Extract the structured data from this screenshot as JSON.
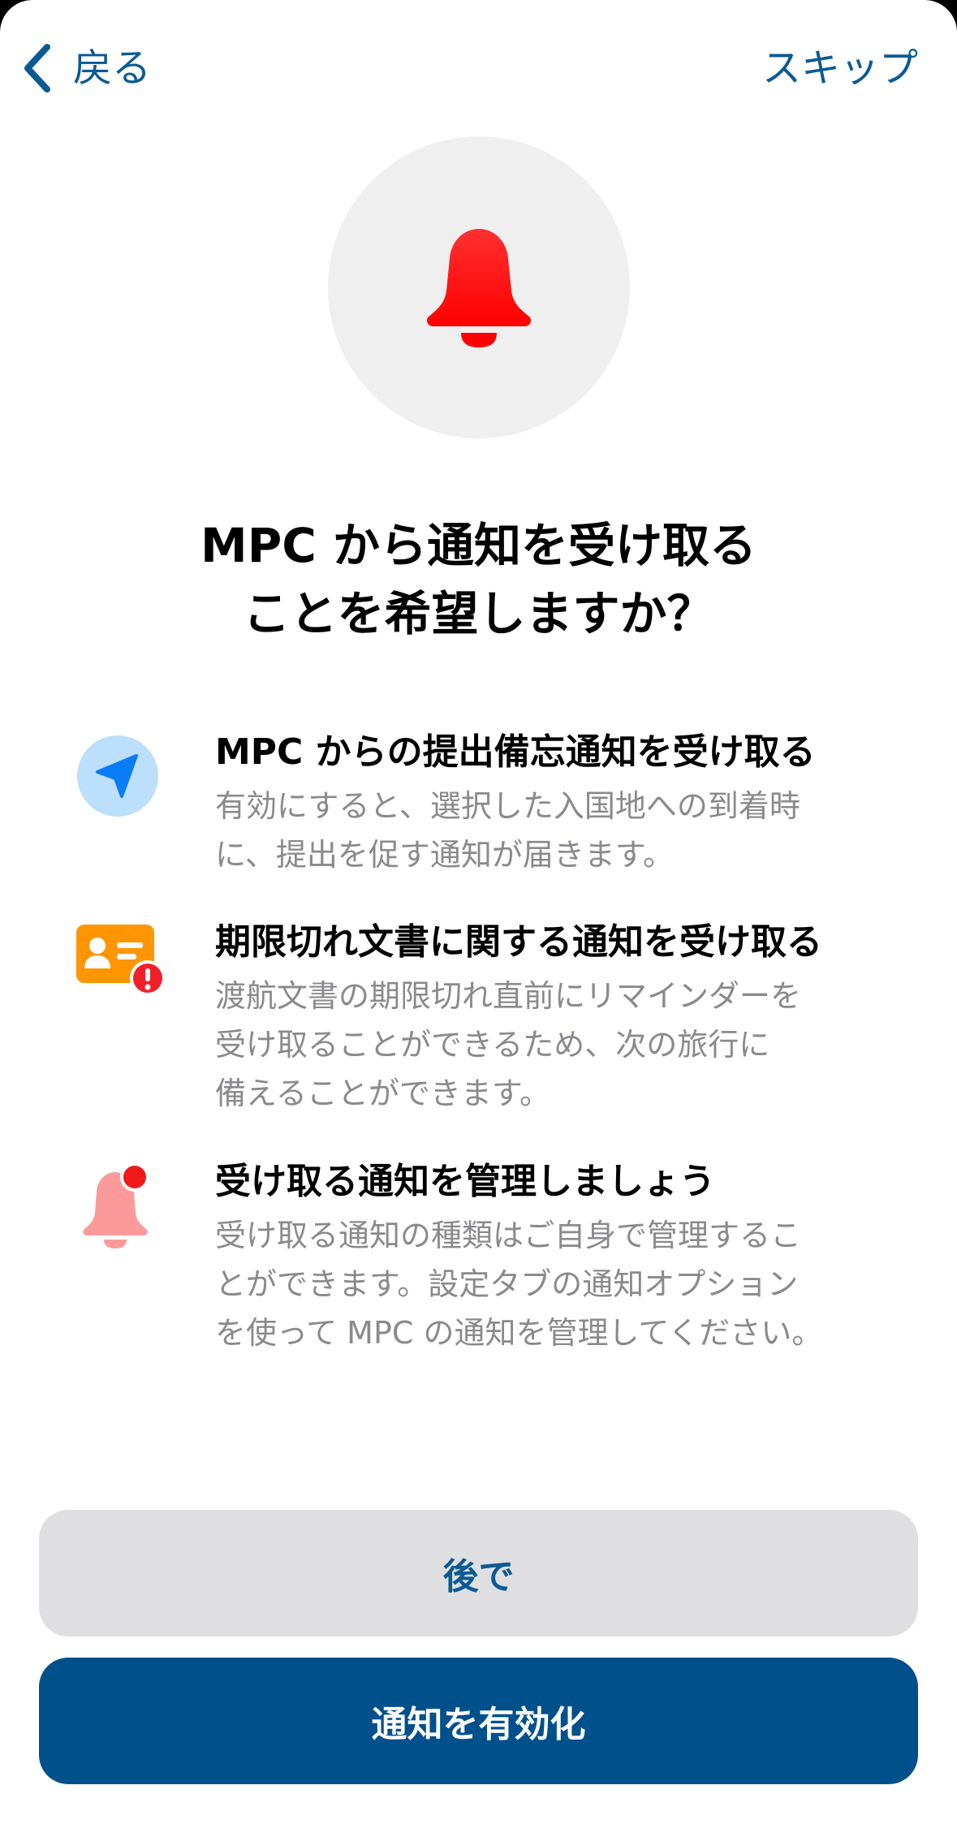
{
  "nav": {
    "back_label": "戻る",
    "skip_label": "スキップ"
  },
  "hero": {
    "icon": "bell-icon",
    "icon_color": "#ff1a1a"
  },
  "title": {
    "line1": "MPC から通知を受け取る",
    "line2": "ことを希望しますか？"
  },
  "features": [
    {
      "icon": "location-arrow-icon",
      "title": "MPC からの提出備忘通知を受け取る",
      "body_lines": [
        "有効にすると、選択した入国地への到着時",
        "に、提出を促す通知が届きます。"
      ]
    },
    {
      "icon": "id-card-alert-icon",
      "title": "期限切れ文書に関する通知を受け取る",
      "body_lines": [
        "渡航文書の期限切れ直前にリマインダーを",
        "受け取ることができるため、次の旅行に",
        "備えることができます。"
      ]
    },
    {
      "icon": "bell-badge-icon",
      "title": "受け取る通知を管理しましょう",
      "body_lines": [
        "受け取る通知の種類はご自身で管理するこ",
        "とができます。設定タブの通知オプション",
        "を使って MPC の通知を管理してください。"
      ]
    }
  ],
  "buttons": {
    "later_label": "後で",
    "enable_label": "通知を有効化"
  },
  "colors": {
    "accent": "#0a5a93",
    "primary_button": "#00508c",
    "secondary_button": "#dfdfe1",
    "body_text": "#8a8a8e"
  }
}
